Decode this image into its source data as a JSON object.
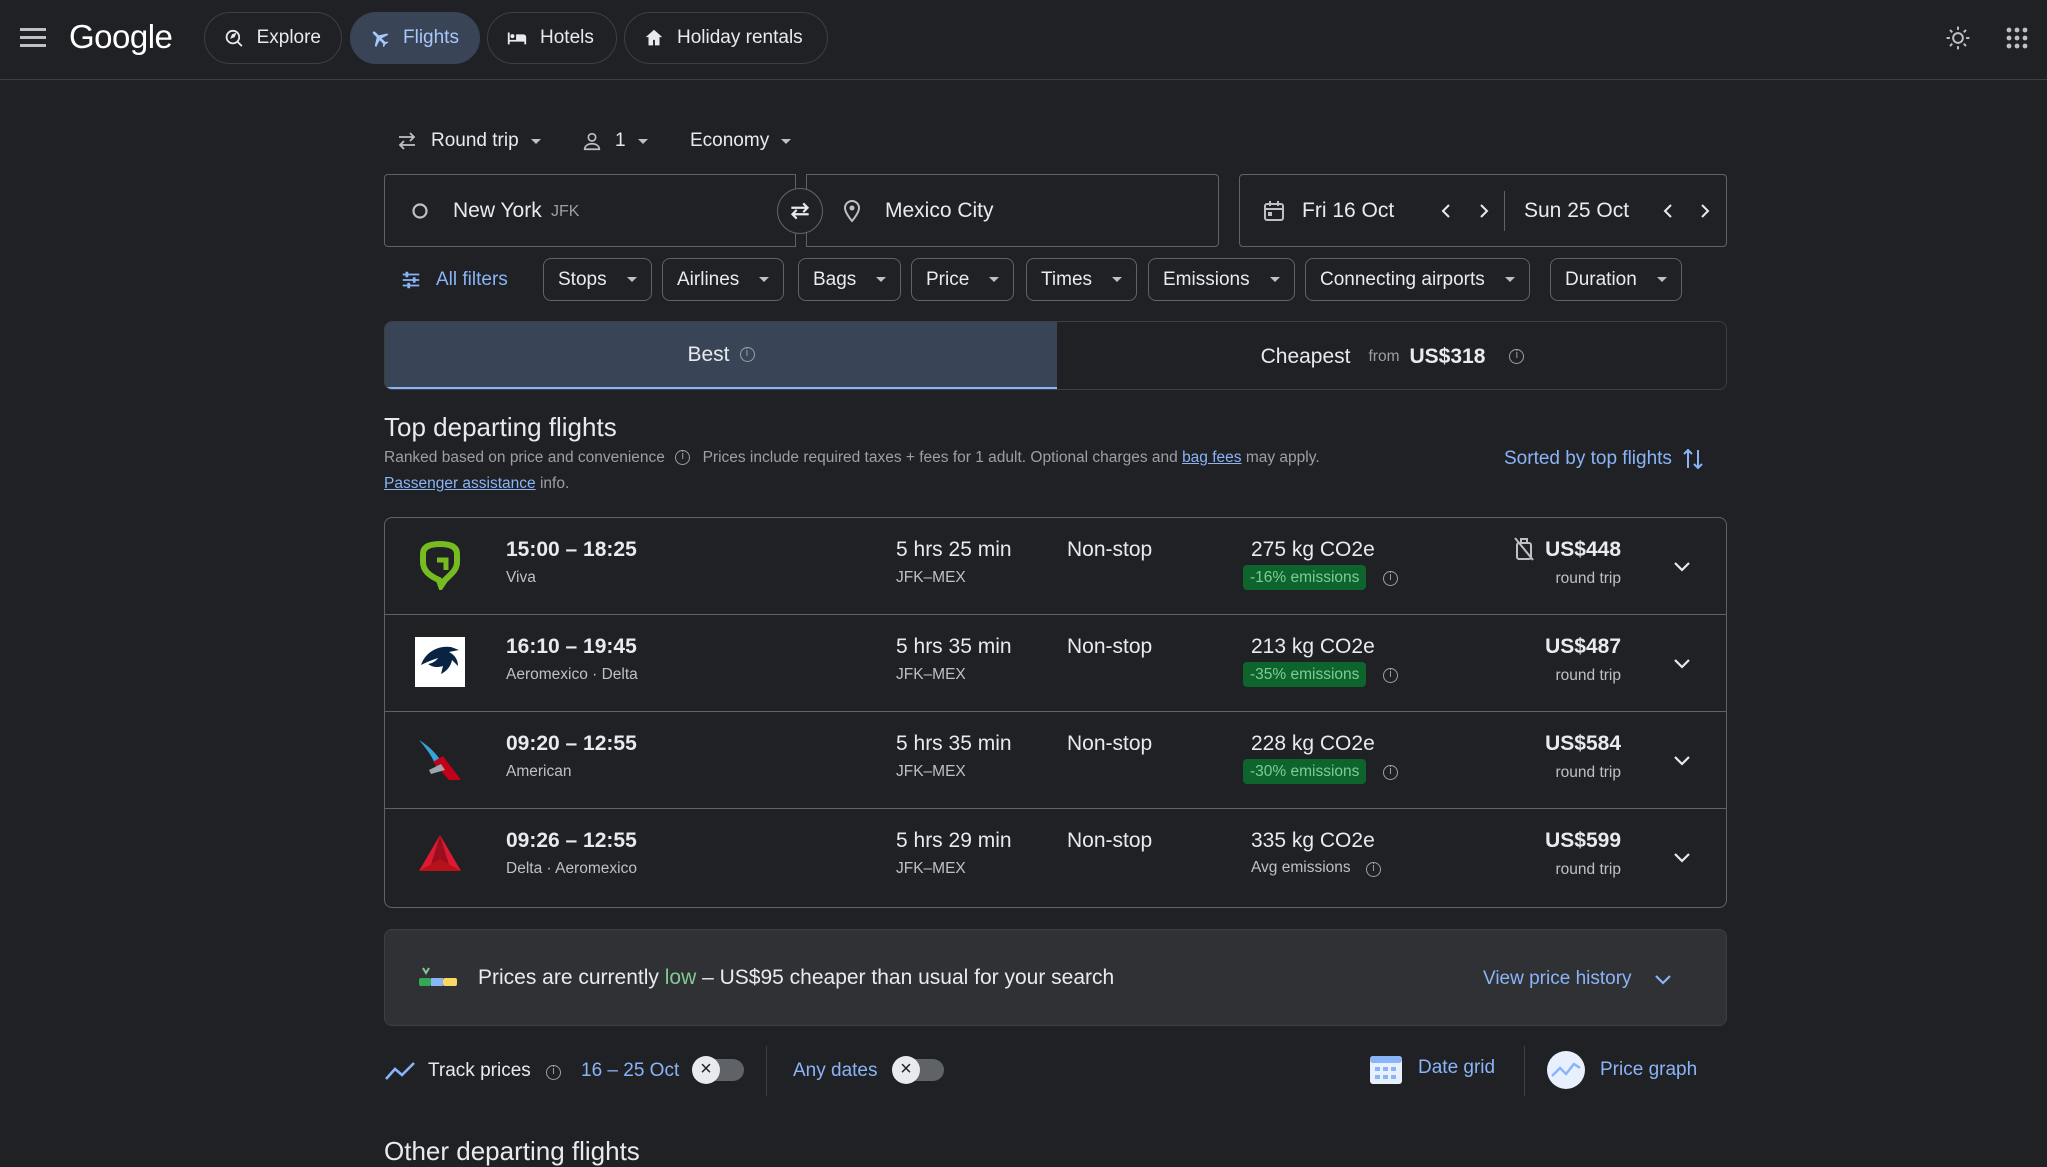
{
  "nav": {
    "logo": "Google",
    "explore": "Explore",
    "flights": "Flights",
    "hotels": "Hotels",
    "holiday_rentals": "Holiday rentals"
  },
  "search": {
    "trip_type": "Round trip",
    "passengers": "1",
    "cabin": "Economy",
    "origin": "New York",
    "origin_code": "JFK",
    "destination": "Mexico City",
    "depart_date": "Fri 16 Oct",
    "return_date": "Sun 25 Oct"
  },
  "filters": {
    "all": "All filters",
    "chips": [
      "Stops",
      "Airlines",
      "Bags",
      "Price",
      "Times",
      "Emissions",
      "Connecting airports",
      "Duration"
    ]
  },
  "tabs": {
    "best": "Best",
    "cheapest": "Cheapest",
    "from": "from",
    "cheapest_price": "US$318"
  },
  "results": {
    "heading": "Top departing flights",
    "ranked": "Ranked based on price and convenience",
    "prices_note_1": "Prices include required taxes + fees for 1 adult. Optional charges and",
    "bag_fees": "bag fees",
    "prices_note_2": "may apply.",
    "passenger_assistance": "Passenger assistance",
    "info": "info.",
    "sorted": "Sorted by top flights"
  },
  "flights": [
    {
      "times": "15:00 – 18:25",
      "airline": "Viva",
      "duration": "5 hrs 25 min",
      "route": "JFK–MEX",
      "stops": "Non-stop",
      "co2": "275 kg CO2e",
      "emissions": "-16% emissions",
      "price": "US$448",
      "price_note": "round trip",
      "logo": "viva-logo-icon",
      "color": "#76bc21"
    },
    {
      "times": "16:10 – 19:45",
      "airline": "Aeromexico · Delta",
      "duration": "5 hrs 35 min",
      "route": "JFK–MEX",
      "stops": "Non-stop",
      "co2": "213 kg CO2e",
      "emissions": "-35% emissions",
      "price": "US$487",
      "price_note": "round trip",
      "logo": "aeromexico-logo-icon",
      "color": "#0b2343"
    },
    {
      "times": "09:20 – 12:55",
      "airline": "American",
      "duration": "5 hrs 35 min",
      "route": "JFK–MEX",
      "stops": "Non-stop",
      "co2": "228 kg CO2e",
      "emissions": "-30% emissions",
      "price": "US$584",
      "price_note": "round trip",
      "logo": "american-logo-icon",
      "color": "#c30019"
    },
    {
      "times": "09:26 – 12:55",
      "airline": "Delta · Aeromexico",
      "duration": "5 hrs 29 min",
      "route": "JFK–MEX",
      "stops": "Non-stop",
      "co2": "335 kg CO2e",
      "emissions": "Avg emissions",
      "price": "US$599",
      "price_note": "round trip",
      "logo": "delta-logo-icon",
      "color": "#e01933"
    }
  ],
  "banner": {
    "text_1": "Prices are currently",
    "low": "low",
    "text_2": "– US$95 cheaper than usual for your search",
    "view_history": "View price history"
  },
  "tracking": {
    "track_prices": "Track prices",
    "dates": "16 – 25 Oct",
    "any_dates": "Any dates",
    "date_grid": "Date grid",
    "price_graph": "Price graph"
  },
  "other": {
    "heading": "Other departing flights"
  }
}
